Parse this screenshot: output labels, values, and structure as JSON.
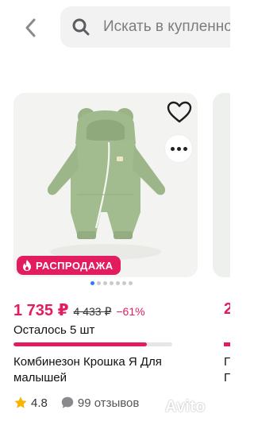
{
  "header": {
    "search_placeholder": "Искать в купленном"
  },
  "icons": {
    "back": "chevron-left-icon",
    "search": "search-icon",
    "favorite": "heart-icon",
    "more": "more-dots-icon",
    "sale": "fire-icon",
    "rating": "star-icon",
    "reviews": "chat-bubble-icon"
  },
  "colors": {
    "accent": "#e31c5f",
    "pager_active": "#2b7bf3",
    "star": "#f7b500"
  },
  "product": {
    "badge": "РАСПРОДАЖА",
    "gallery": {
      "current_index": 1,
      "count": 7
    },
    "price": "1 735 ₽",
    "old_price": "4 433 ₽",
    "discount": "−61%",
    "stock_text": "Осталось 5 шт",
    "stock_level": 0.84,
    "title": "Комбинезон Крошка Я Для малышей",
    "rating": "4.8",
    "reviews": "99 отзывов"
  },
  "next_product": {
    "price_partial": "2",
    "title_partial_1": "Г",
    "title_partial_2": "Г"
  },
  "watermark": {
    "text": "Avito"
  }
}
